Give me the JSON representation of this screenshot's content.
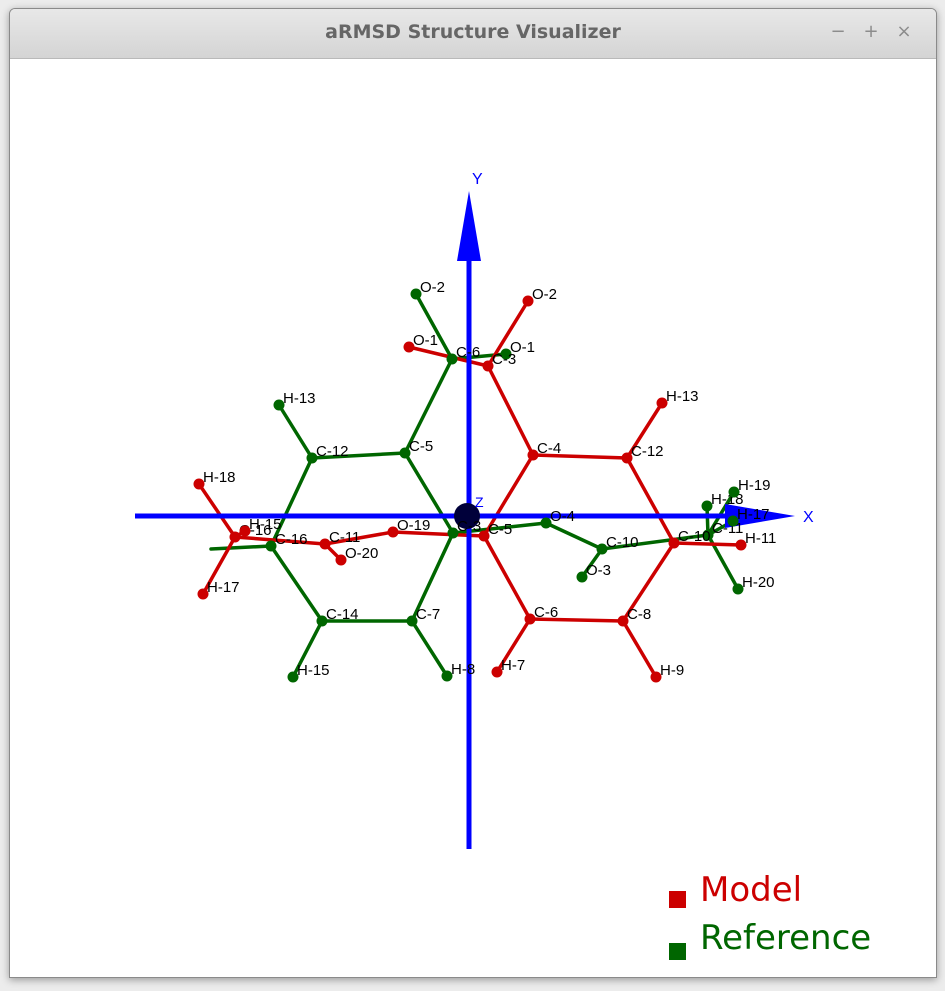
{
  "window": {
    "title": "aRMSD Structure Visualizer",
    "controls": {
      "minimize": "−",
      "maximize": "+",
      "close": "×"
    }
  },
  "axes": {
    "x_label": "X",
    "y_label": "Y",
    "z_label": "Z",
    "color": "#0000ff"
  },
  "legend": {
    "model_label": "Model",
    "reference_label": "Reference",
    "model_color": "#cc0000",
    "reference_color": "#006600"
  },
  "atoms_model": [
    {
      "id": "m-o1",
      "label": "O-1"
    },
    {
      "id": "m-o2",
      "label": "O-2"
    },
    {
      "id": "m-c3",
      "label": "C-3"
    },
    {
      "id": "m-c4",
      "label": "C-4"
    },
    {
      "id": "m-c12",
      "label": "C-12"
    },
    {
      "id": "m-h13",
      "label": "H-13"
    },
    {
      "id": "m-c10",
      "label": "C-10"
    },
    {
      "id": "m-h11",
      "label": "H-11"
    },
    {
      "id": "m-c8",
      "label": "C-8"
    },
    {
      "id": "m-h9",
      "label": "H-9"
    },
    {
      "id": "m-c6",
      "label": "C-6"
    },
    {
      "id": "m-h7",
      "label": "H-7"
    },
    {
      "id": "m-c5",
      "label": "C-5"
    },
    {
      "id": "m-o19",
      "label": "O-19"
    },
    {
      "id": "m-c11",
      "label": "C-11"
    },
    {
      "id": "m-o20",
      "label": "O-20"
    },
    {
      "id": "m-c16",
      "label": "C-16"
    },
    {
      "id": "m-h18",
      "label": "H-18"
    },
    {
      "id": "m-h17",
      "label": "H-17"
    },
    {
      "id": "m-h15",
      "label": "H-15"
    }
  ],
  "atoms_reference": [
    {
      "id": "r-o2",
      "label": "O-2"
    },
    {
      "id": "r-o1",
      "label": "O-1"
    },
    {
      "id": "r-c6",
      "label": "C-6"
    },
    {
      "id": "r-c5",
      "label": "C-5"
    },
    {
      "id": "r-c12",
      "label": "C-12"
    },
    {
      "id": "r-h13",
      "label": "H-13"
    },
    {
      "id": "r-c16",
      "label": "C-16"
    },
    {
      "id": "r-c14",
      "label": "C-14"
    },
    {
      "id": "r-h15",
      "label": "H-15"
    },
    {
      "id": "r-c7",
      "label": "C-7"
    },
    {
      "id": "r-h8",
      "label": "H-8"
    },
    {
      "id": "r-c3",
      "label": "C-3"
    },
    {
      "id": "r-o4",
      "label": "O-4"
    },
    {
      "id": "r-c10",
      "label": "C-10"
    },
    {
      "id": "r-o3",
      "label": "O-3"
    },
    {
      "id": "r-c11",
      "label": "C-11"
    },
    {
      "id": "r-h18",
      "label": "H-18"
    },
    {
      "id": "r-h19",
      "label": "H-19"
    },
    {
      "id": "r-h17",
      "label": "H-17"
    },
    {
      "id": "r-h20",
      "label": "H-20"
    }
  ]
}
